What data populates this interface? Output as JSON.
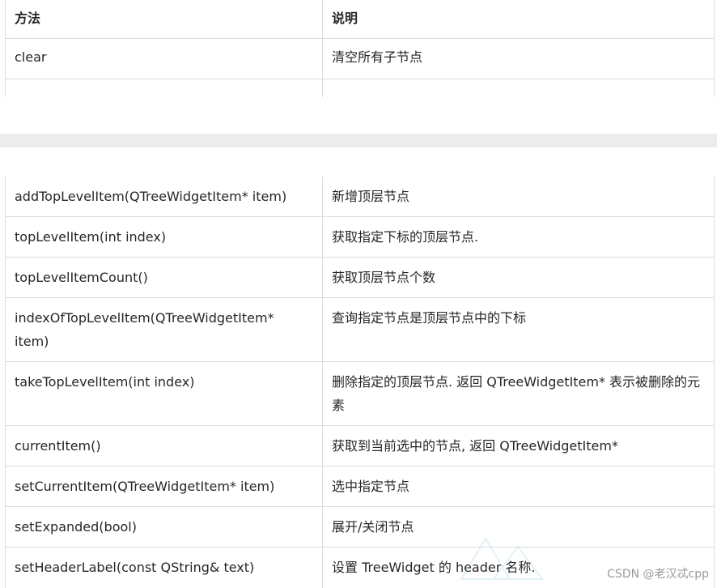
{
  "table_top": {
    "header": {
      "method": "方法",
      "desc": "说明"
    },
    "rows": [
      {
        "method": "clear",
        "desc": "清空所有子节点"
      },
      {
        "method": "",
        "desc": ""
      }
    ]
  },
  "table_main": {
    "rows": [
      {
        "method": "addTopLevelItem(QTreeWidgetItem* item)",
        "desc": "新增顶层节点"
      },
      {
        "method": "topLevelItem(int index)",
        "desc": "获取指定下标的顶层节点."
      },
      {
        "method": "topLevelItemCount()",
        "desc": "获取顶层节点个数"
      },
      {
        "method": "indexOfTopLevelItem(QTreeWidgetItem* item)",
        "desc": "查询指定节点是顶层节点中的下标"
      },
      {
        "method": "takeTopLevelItem(int index)",
        "desc": "删除指定的顶层节点. 返回 QTreeWidgetItem* 表示被删除的元素"
      },
      {
        "method": "currentItem()",
        "desc": "获取到当前选中的节点, 返回 QTreeWidgetItem*"
      },
      {
        "method": "setCurrentItem(QTreeWidgetItem* item)",
        "desc": "选中指定节点"
      },
      {
        "method": "setExpanded(bool)",
        "desc": "展开/关闭节点"
      },
      {
        "method": "setHeaderLabel(const QString& text)",
        "desc": "设置 TreeWidget 的 header 名称."
      }
    ]
  },
  "watermark": "CSDN @老汉忒cpp"
}
